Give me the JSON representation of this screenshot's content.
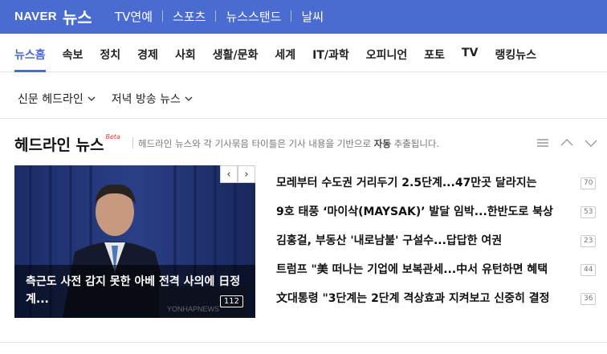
{
  "header": {
    "brand": "NAVER",
    "service": "뉴스",
    "nav": [
      "TV연예",
      "스포츠",
      "뉴스스탠드",
      "날씨"
    ]
  },
  "sections": {
    "active_index": 0,
    "items": [
      "뉴스홈",
      "속보",
      "정치",
      "경제",
      "사회",
      "생활/문화",
      "세계",
      "IT/과학",
      "오피니언",
      "포토",
      "TV",
      "랭킹뉴스"
    ]
  },
  "filters": [
    "신문 헤드라인",
    "저녁 방송 뉴스"
  ],
  "headline": {
    "title": "헤드라인 뉴스",
    "badge": "Beta",
    "desc_pre": "헤드라인 뉴스와 각 기사묶음 타이틀은 기사 내용을 기반으로 ",
    "desc_bold": "자동",
    "desc_post": " 추출됩니다."
  },
  "photo": {
    "caption": "측근도 사전 감지 못한 아베 전격 사의에 日정계...",
    "count": "112",
    "watermark": "YONHAPNEWS"
  },
  "articles": [
    {
      "title": "모레부터 수도권 거리두기 2.5단계...47만곳 달라지는",
      "count": "70"
    },
    {
      "title": "9호 태풍 ‘마이삭(MAYSAK)’ 발달 임박...한반도로 북상",
      "count": "53"
    },
    {
      "title": "김홍걸, 부동산 '내로남불' 구설수...답답한 여권",
      "count": "23"
    },
    {
      "title": "트럼프 \"美 떠나는 기업에 보복관세...中서 유턴하면 혜택",
      "count": "44"
    },
    {
      "title": "文대통령 \"3단계는 2단계 격상효과 지켜보고 신중히 결정",
      "count": "36"
    }
  ]
}
